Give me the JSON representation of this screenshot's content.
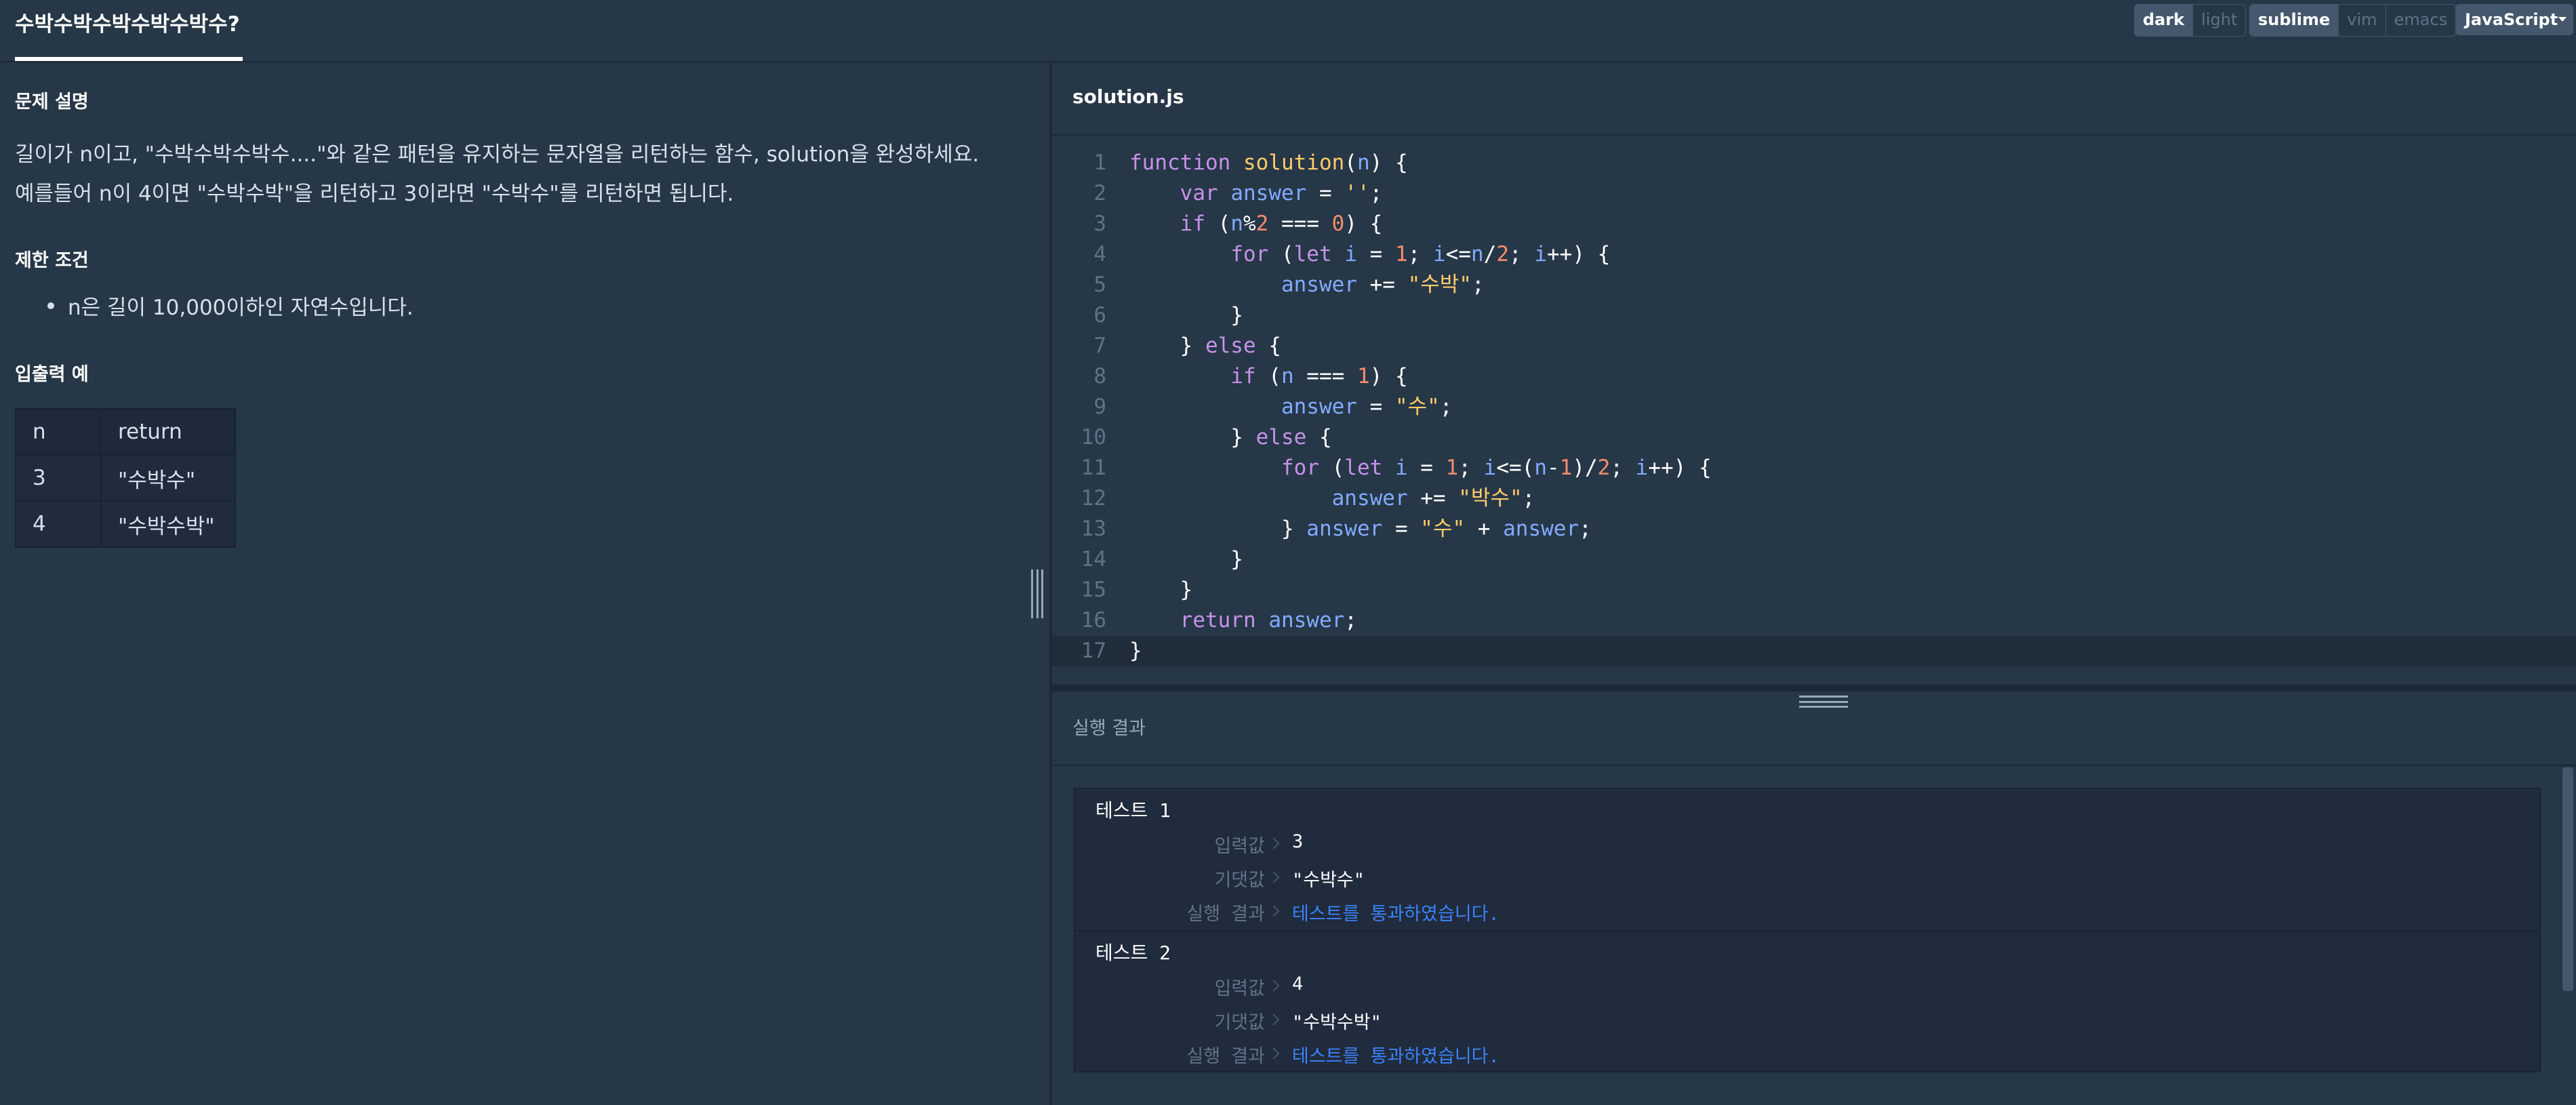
{
  "header": {
    "title": "수박수박수박수박수박수?",
    "theme_options": [
      "dark",
      "light"
    ],
    "theme_selected": "dark",
    "keymap_options": [
      "sublime",
      "vim",
      "emacs"
    ],
    "keymap_selected": "sublime",
    "language": "JavaScript"
  },
  "problem": {
    "desc_heading": "문제 설명",
    "desc_lines": [
      "길이가 n이고, \"수박수박수박수....\"와 같은 패턴을 유지하는 문자열을 리턴하는 함수, solution을 완성하세요.",
      "예를들어 n이 4이면 \"수박수박\"을 리턴하고 3이라면 \"수박수\"를 리턴하면 됩니다."
    ],
    "constraint_heading": "제한 조건",
    "constraints": [
      "n은 길이 10,000이하인 자연수입니다."
    ],
    "example_heading": "입출력 예",
    "table": {
      "headers": [
        "n",
        "return"
      ],
      "rows": [
        [
          "3",
          "\"수박수\""
        ],
        [
          "4",
          "\"수박수박\""
        ]
      ]
    }
  },
  "editor": {
    "file_name": "solution.js",
    "line_numbers": [
      "1",
      "2",
      "3",
      "4",
      "5",
      "6",
      "7",
      "8",
      "9",
      "10",
      "11",
      "12",
      "13",
      "14",
      "15",
      "16",
      "17"
    ],
    "lines": [
      "function solution(n) {",
      "    var answer = '';",
      "    if (n%2 === 0) {",
      "        for (let i = 1; i<=n/2; i++) {",
      "            answer += \"수박\";",
      "        }",
      "    } else {",
      "        if (n === 1) {",
      "            answer = \"수\";",
      "        } else {",
      "            for (let i = 1; i<=(n-1)/2; i++) {",
      "                answer += \"박수\";",
      "            } answer = \"수\" + answer;",
      "        }",
      "    }",
      "    return answer;",
      "}"
    ]
  },
  "result": {
    "title": "실행 결과",
    "labels": {
      "input": "입력값",
      "expected": "기댓값",
      "outcome": "실행 결과"
    },
    "tests": [
      {
        "title": "테스트 1",
        "input": "3",
        "expected": "\"수박수\"",
        "outcome": "테스트를 통과하였습니다."
      },
      {
        "title": "테스트 2",
        "input": "4",
        "expected": "\"수박수박\"",
        "outcome": "테스트를 통과하였습니다."
      }
    ]
  },
  "colors": {
    "background": "#263747",
    "panel": "#202b3d",
    "pass": "#3b82f6",
    "keyword": "#c792ea",
    "function": "#ffcb6b",
    "string": "#ffcb6b",
    "number": "#f78c6c",
    "variable": "#82aaff"
  }
}
